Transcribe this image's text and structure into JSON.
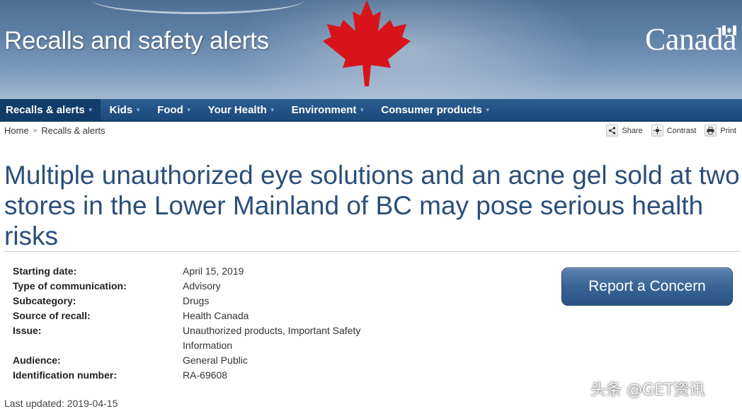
{
  "banner": {
    "title": "Recalls and safety alerts",
    "wordmark": "Canada"
  },
  "nav": {
    "items": [
      {
        "label": "Recalls & alerts",
        "active": true
      },
      {
        "label": "Kids"
      },
      {
        "label": "Food"
      },
      {
        "label": "Your Health"
      },
      {
        "label": "Environment"
      },
      {
        "label": "Consumer products"
      }
    ]
  },
  "breadcrumb": {
    "home": "Home",
    "current": "Recalls & alerts"
  },
  "tools": {
    "share": "Share",
    "contrast": "Contrast",
    "print": "Print"
  },
  "page": {
    "title": "Multiple unauthorized eye solutions and an acne gel sold at two stores in the Lower Mainland of BC may pose serious health risks"
  },
  "details": [
    {
      "label": "Starting date:",
      "value": "April 15, 2019"
    },
    {
      "label": "Type of communication:",
      "value": "Advisory"
    },
    {
      "label": "Subcategory:",
      "value": "Drugs"
    },
    {
      "label": "Source of recall:",
      "value": "Health Canada"
    },
    {
      "label": "Issue:",
      "value": "Unauthorized products, Important Safety Information"
    },
    {
      "label": "Audience:",
      "value": "General Public"
    },
    {
      "label": "Identification number:",
      "value": "RA-69608"
    }
  ],
  "actions": {
    "report_concern": "Report a Concern"
  },
  "footer": {
    "last_updated": "Last updated: 2019-04-15"
  },
  "watermark": "头条 @GET资讯",
  "colors": {
    "nav_bg": "#1b4a7c",
    "title_blue": "#2a4f7a",
    "leaf_red": "#d8141a",
    "button_blue": "#3a6496"
  }
}
